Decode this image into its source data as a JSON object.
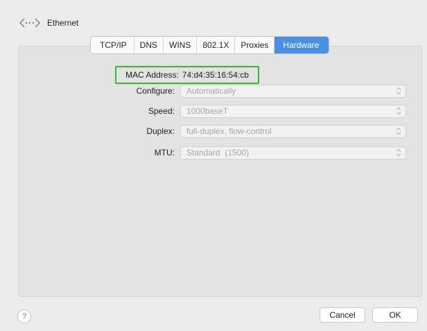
{
  "header": {
    "title": "Ethernet",
    "icon": "ethernet-icon"
  },
  "tabs": [
    {
      "label": "TCP/IP",
      "selected": false
    },
    {
      "label": "DNS",
      "selected": false
    },
    {
      "label": "WINS",
      "selected": false
    },
    {
      "label": "802.1X",
      "selected": false
    },
    {
      "label": "Proxies",
      "selected": false
    },
    {
      "label": "Hardware",
      "selected": true
    }
  ],
  "mac": {
    "label": "MAC Address:",
    "value": "74:d4:35:16:54:cb",
    "highlight_color": "#2bc02b"
  },
  "fields": {
    "configure": {
      "label": "Configure:",
      "value": "Automatically"
    },
    "speed": {
      "label": "Speed:",
      "value": "1000baseT"
    },
    "duplex": {
      "label": "Duplex:",
      "value": "full-duplex, flow-control"
    },
    "mtu": {
      "label": "MTU:",
      "value": "Standard  (1500)"
    }
  },
  "footer": {
    "help_label": "?",
    "cancel_label": "Cancel",
    "ok_label": "OK"
  },
  "colors": {
    "accent": "#4a90e2",
    "panel_bg": "#e3e3e3",
    "window_bg": "#ececec"
  }
}
